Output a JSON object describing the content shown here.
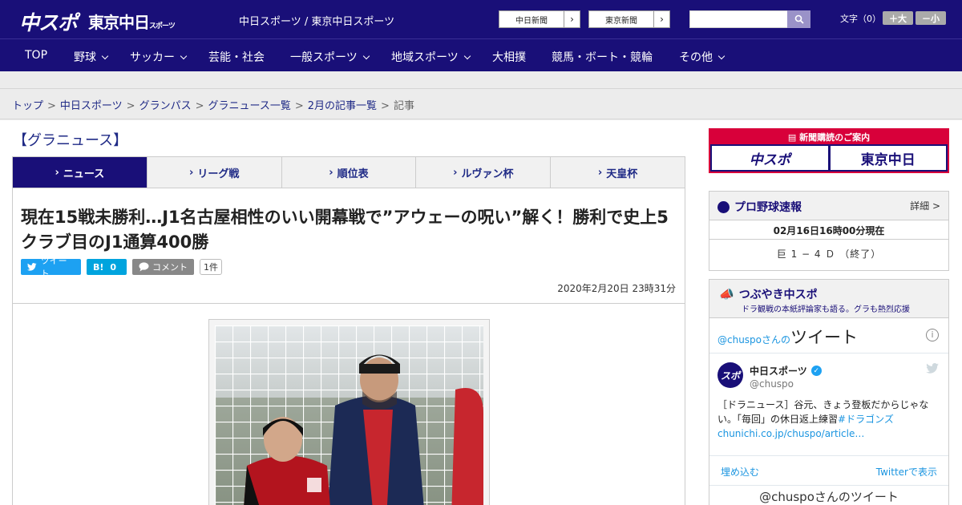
{
  "header": {
    "logo_chuspo": "中スポ",
    "logo_tokyo": "東京中日",
    "logo_tokyo_small": "スポーツ",
    "site_names": "中日スポーツ / 東京中日スポーツ",
    "paper_buttons": [
      {
        "label": "中日新聞"
      },
      {
        "label": "東京新聞"
      }
    ],
    "search": {
      "placeholder": ""
    },
    "font_size_label": "文字（0）",
    "font_bigger": "＋大",
    "font_smaller": "－小"
  },
  "nav": {
    "items": [
      {
        "label": "TOP",
        "dropdown": false
      },
      {
        "label": "野球",
        "dropdown": true
      },
      {
        "label": "サッカー",
        "dropdown": true
      },
      {
        "label": "芸能・社会",
        "dropdown": false
      },
      {
        "label": "一般スポーツ",
        "dropdown": true
      },
      {
        "label": "地域スポーツ",
        "dropdown": true
      },
      {
        "label": "大相撲",
        "dropdown": false
      },
      {
        "label": "競馬・ボート・競輪",
        "dropdown": false
      },
      {
        "label": "その他",
        "dropdown": true
      }
    ]
  },
  "breadcrumb": {
    "items": [
      "トップ",
      "中日スポーツ",
      "グランパス",
      "グラニュース一覧",
      "2月の記事一覧"
    ],
    "current": "記事",
    "separator": ">"
  },
  "section": {
    "title": "【グラニュース】"
  },
  "tabs": [
    {
      "label": "ニュース",
      "active": true
    },
    {
      "label": "リーグ戦",
      "active": false
    },
    {
      "label": "順位表",
      "active": false
    },
    {
      "label": "ルヴァン杯",
      "active": false
    },
    {
      "label": "天皇杯",
      "active": false
    }
  ],
  "article": {
    "headline": "現在15戦未勝利…J1名古屋相性のいい開幕戦で”アウェーの呪い”解く！勝利で史上5クラブ目のJ1通算400勝",
    "tweet_label": "ツイート",
    "hatena_label": "B!",
    "hatena_count": "0",
    "comment_label": "コメント",
    "comment_count": "1件",
    "date": "2020年2月20日 23時31分"
  },
  "sidebar": {
    "subscription": {
      "caption": "新聞購読のご案内",
      "logo1": "中スポ",
      "logo2": "東京中日"
    },
    "baseball": {
      "title": "プロ野球速報",
      "more": "詳細 >",
      "time": "02月16日16時00分現在",
      "score": "巨 1 − 4 Ｄ （終了）"
    },
    "tsubuyaki": {
      "title": "つぶやき中スポ",
      "subtitle": "ドラ観戦の本紙評論家も語る。グラも熱烈応援",
      "timeline_prefix": "@chuspoさんの",
      "timeline_title": "ツイート",
      "tweet": {
        "name": "中日スポーツ",
        "handle": "@chuspo",
        "text": "［ドラニュース］谷元、きょう登板だからじゃない。「毎回」の休日返上練習",
        "hashtag": "#ドラゴンズ",
        "link": "chunichi.co.jp/chuspo/article…"
      },
      "embed": "埋め込む",
      "view_on_twitter": "Twitterで表示",
      "more_title": "@chuspoさんのツイート"
    }
  },
  "colors": {
    "brand_navy": "#190f78",
    "accent_red": "#d8003a",
    "twitter_blue": "#1da1f2"
  }
}
